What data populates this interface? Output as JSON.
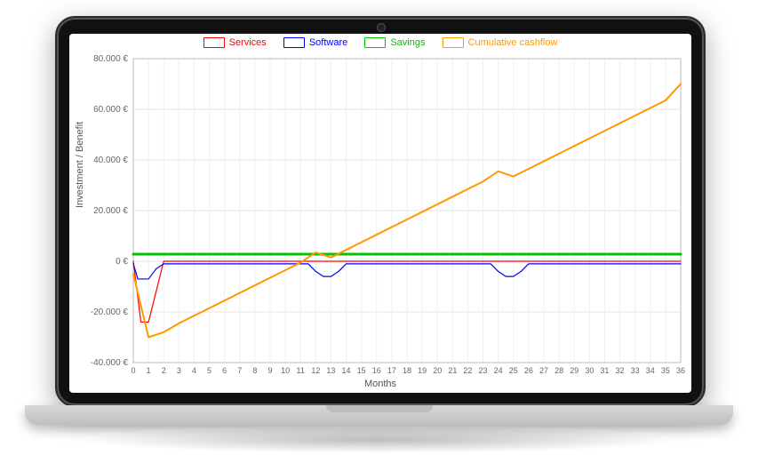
{
  "chart_data": {
    "type": "line",
    "xlabel": "Months",
    "ylabel": "Investment / Benefit",
    "xlim": [
      0,
      36
    ],
    "ylim": [
      -40000,
      80000
    ],
    "x_ticks": [
      0,
      1,
      2,
      3,
      4,
      5,
      6,
      7,
      8,
      9,
      10,
      11,
      12,
      13,
      14,
      15,
      16,
      17,
      18,
      19,
      20,
      21,
      22,
      23,
      24,
      25,
      26,
      27,
      28,
      29,
      30,
      31,
      32,
      33,
      34,
      35,
      36
    ],
    "y_ticks_values": [
      -40000,
      -20000,
      0,
      20000,
      40000,
      60000,
      80000
    ],
    "y_tick_labels": [
      "-40.000 €",
      "-20.000 €",
      "0 €",
      "20.000 €",
      "40.000 €",
      "60.000 €",
      "80.000 €"
    ],
    "series": [
      {
        "name": "Services",
        "color": "#ff0000",
        "stroke": 1.2,
        "x": [
          0,
          0.5,
          1,
          1.5,
          2,
          3,
          4,
          36
        ],
        "y": [
          0,
          -24000,
          -24000,
          -12000,
          0,
          0,
          0,
          0
        ]
      },
      {
        "name": "Software",
        "color": "#0000ff",
        "stroke": 1.2,
        "x": [
          0,
          0.3,
          1,
          1.5,
          2,
          11.5,
          12,
          12.5,
          13,
          13.5,
          14,
          23.5,
          24,
          24.5,
          25,
          25.5,
          26,
          36
        ],
        "y": [
          -1000,
          -7000,
          -7000,
          -3000,
          -1000,
          -1000,
          -4000,
          -6000,
          -6000,
          -4000,
          -1000,
          -1000,
          -4000,
          -6000,
          -6000,
          -4000,
          -1000,
          -1000
        ]
      },
      {
        "name": "Savings",
        "color": "#00c400",
        "stroke": 3,
        "x": [
          0,
          36
        ],
        "y": [
          2800,
          2800
        ]
      },
      {
        "name": "Cumulative cashflow",
        "color": "#ff9900",
        "stroke": 2,
        "x": [
          0,
          1,
          2,
          3,
          4,
          5,
          6,
          7,
          8,
          9,
          10,
          11,
          12,
          13,
          14,
          15,
          16,
          17,
          18,
          19,
          20,
          21,
          22,
          23,
          24,
          25,
          26,
          27,
          28,
          29,
          30,
          31,
          32,
          33,
          34,
          35,
          36
        ],
        "y": [
          -5000,
          -30000,
          -28000,
          -24500,
          -21500,
          -18500,
          -15500,
          -12500,
          -9500,
          -6500,
          -3500,
          -500,
          3500,
          1500,
          4500,
          7500,
          10500,
          13500,
          16500,
          19500,
          22500,
          25500,
          28500,
          31500,
          35500,
          33500,
          36500,
          39500,
          42500,
          45500,
          48500,
          51500,
          54500,
          57500,
          60500,
          63500,
          70000
        ]
      }
    ]
  },
  "legend": {
    "services": "Services",
    "software": "Software",
    "savings": "Savings",
    "cumulative": "Cumulative cashflow"
  },
  "axis": {
    "xlabel": "Months",
    "ylabel": "Investment / Benefit"
  }
}
